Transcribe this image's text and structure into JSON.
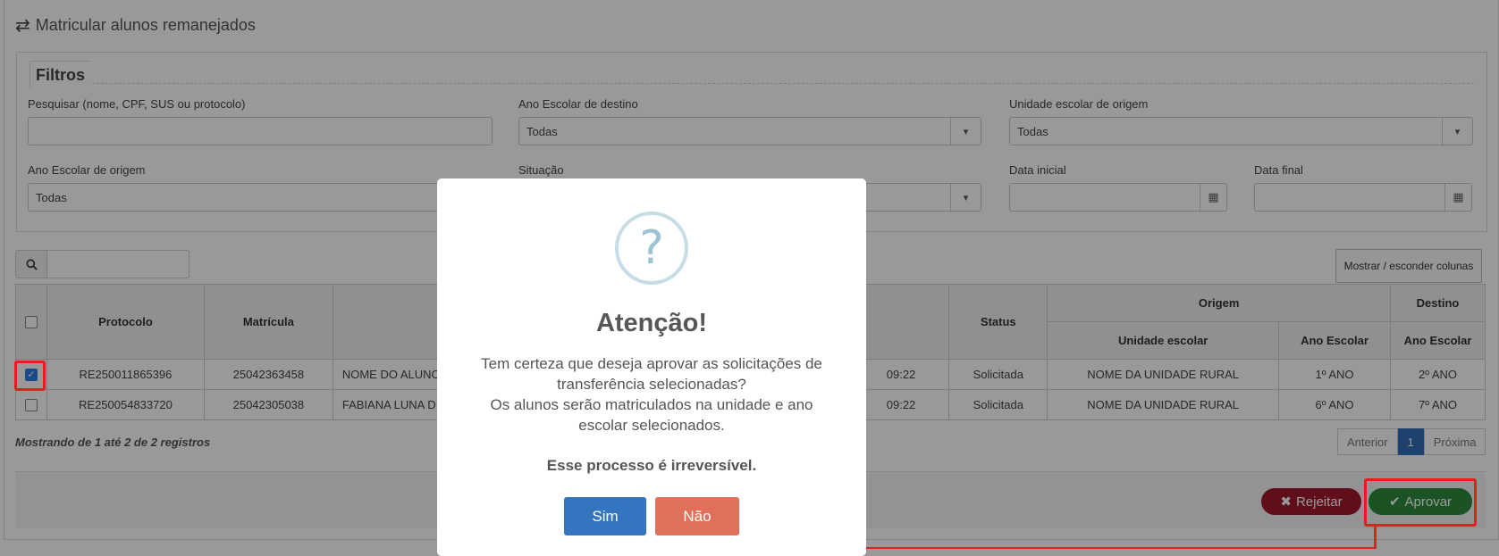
{
  "page": {
    "title": "Matricular alunos remanejados"
  },
  "filters": {
    "legend": "Filtros",
    "search": {
      "label": "Pesquisar (nome, CPF, SUS ou protocolo)",
      "value": ""
    },
    "ano_destino": {
      "label": "Ano Escolar de destino",
      "value": "Todas"
    },
    "unidade_origem": {
      "label": "Unidade escolar de origem",
      "value": "Todas"
    },
    "ano_origem": {
      "label": "Ano Escolar de origem",
      "value": "Todas"
    },
    "situacao": {
      "label": "Situação",
      "value": ""
    },
    "data_inicial": {
      "label": "Data inicial",
      "value": ""
    },
    "data_final": {
      "label": "Data final",
      "value": ""
    }
  },
  "table_tools": {
    "search_value": "",
    "columns_button": "Mostrar / esconder colunas"
  },
  "table": {
    "headers": {
      "protocolo": "Protocolo",
      "matricula": "Matrícula",
      "status": "Status",
      "origem": "Origem",
      "destino": "Destino",
      "unidade_escolar": "Unidade escolar",
      "ano_escolar_origem": "Ano Escolar",
      "ano_escolar_destino": "Ano Escolar"
    },
    "rows": [
      {
        "checked": true,
        "protocolo": "RE250011865396",
        "matricula": "25042363458",
        "nome": "NOME DO ALUNO",
        "hora": "09:22",
        "status": "Solicitada",
        "unidade": "NOME DA UNIDADE RURAL",
        "ano_origem": "1º ANO",
        "ano_destino": "2º ANO"
      },
      {
        "checked": false,
        "protocolo": "RE250054833720",
        "matricula": "25042305038",
        "nome": "FABIANA LUNA D",
        "hora": "09:22",
        "status": "Solicitada",
        "unidade": "NOME DA UNIDADE RURAL",
        "ano_origem": "6º ANO",
        "ano_destino": "7º ANO"
      }
    ],
    "showing": "Mostrando de 1 até 2 de 2 registros",
    "pager": {
      "prev": "Anterior",
      "current": "1",
      "next": "Próxima"
    }
  },
  "actions": {
    "reject": "Rejeitar",
    "approve": "Aprovar"
  },
  "modal": {
    "icon": "?",
    "title": "Atenção!",
    "line1": "Tem certeza que deseja aprovar as solicitações de transferência selecionadas?",
    "line2": "Os alunos serão matriculados na unidade e ano escolar selecionados.",
    "warning": "Esse processo é irreversível.",
    "confirm": "Sim",
    "cancel": "Não"
  },
  "colors": {
    "approve": "#2e8b3e",
    "reject": "#a0182c",
    "highlight": "#e41e1e",
    "confirm": "#3475c0",
    "cancel": "#e0705a"
  }
}
